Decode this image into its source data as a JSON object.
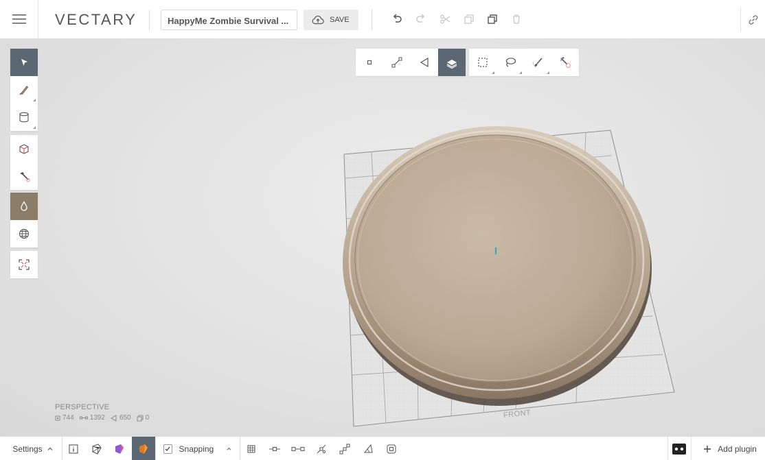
{
  "app": {
    "brand": "VECTARY",
    "project_name": "HappyMe Zombie Survival ...",
    "save_label": "SAVE"
  },
  "viewport": {
    "camera_label": "PERSPECTIVE",
    "stats": {
      "vertices": "744",
      "edges": "1392",
      "faces": "650",
      "objects": "0"
    },
    "grid_front_label": "FRONT"
  },
  "bottom": {
    "settings_label": "Settings",
    "snapping_label": "Snapping",
    "add_plugin_label": "Add plugin"
  },
  "colors": {
    "active_tool": "#5b6772",
    "material_active": "#8b7d6a",
    "model_color": "#c4b4a0",
    "render_color": "#e07a20"
  }
}
